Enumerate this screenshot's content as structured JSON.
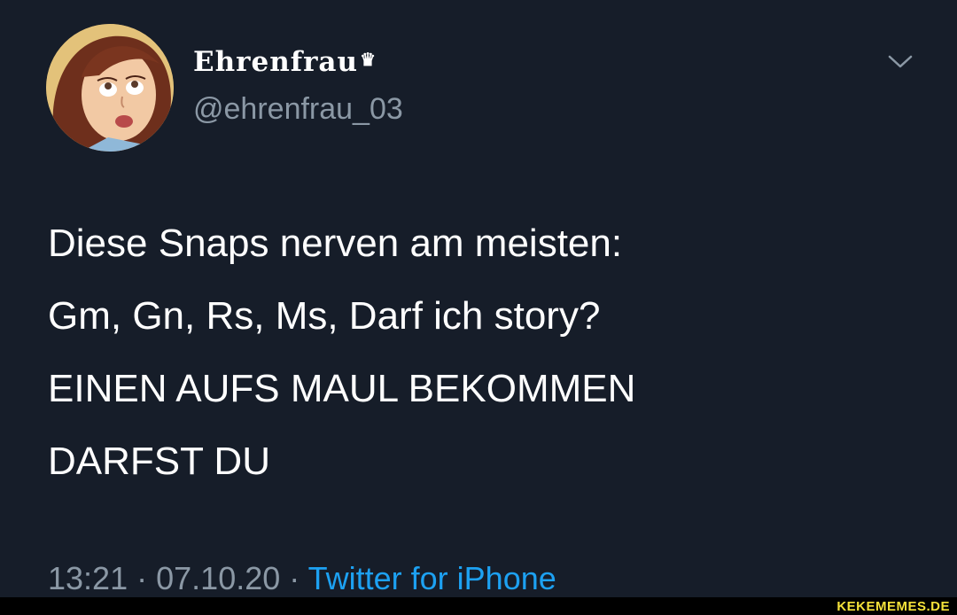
{
  "tweet": {
    "display_name": "Ehrenfrau",
    "name_badge": "♛",
    "handle": "@ehrenfrau_03",
    "text_lines": [
      "Diese Snaps nerven am meisten:",
      "Gm, Gn, Rs, Ms, Darf ich story?",
      "EINEN AUFS MAUL BEKOMMEN",
      "DARFST DU"
    ],
    "time": "13:21",
    "separator": "·",
    "date": "07.10.20",
    "source": "Twitter for iPhone"
  },
  "icons": {
    "avatar": "cartoon-avatar",
    "menu": "chevron-down-icon"
  },
  "watermark": "KEKEMEMES.DE",
  "colors": {
    "background": "#161d29",
    "text": "#ffffff",
    "muted": "#8b98a5",
    "link": "#1da1f2",
    "watermark": "#f5e23a"
  }
}
